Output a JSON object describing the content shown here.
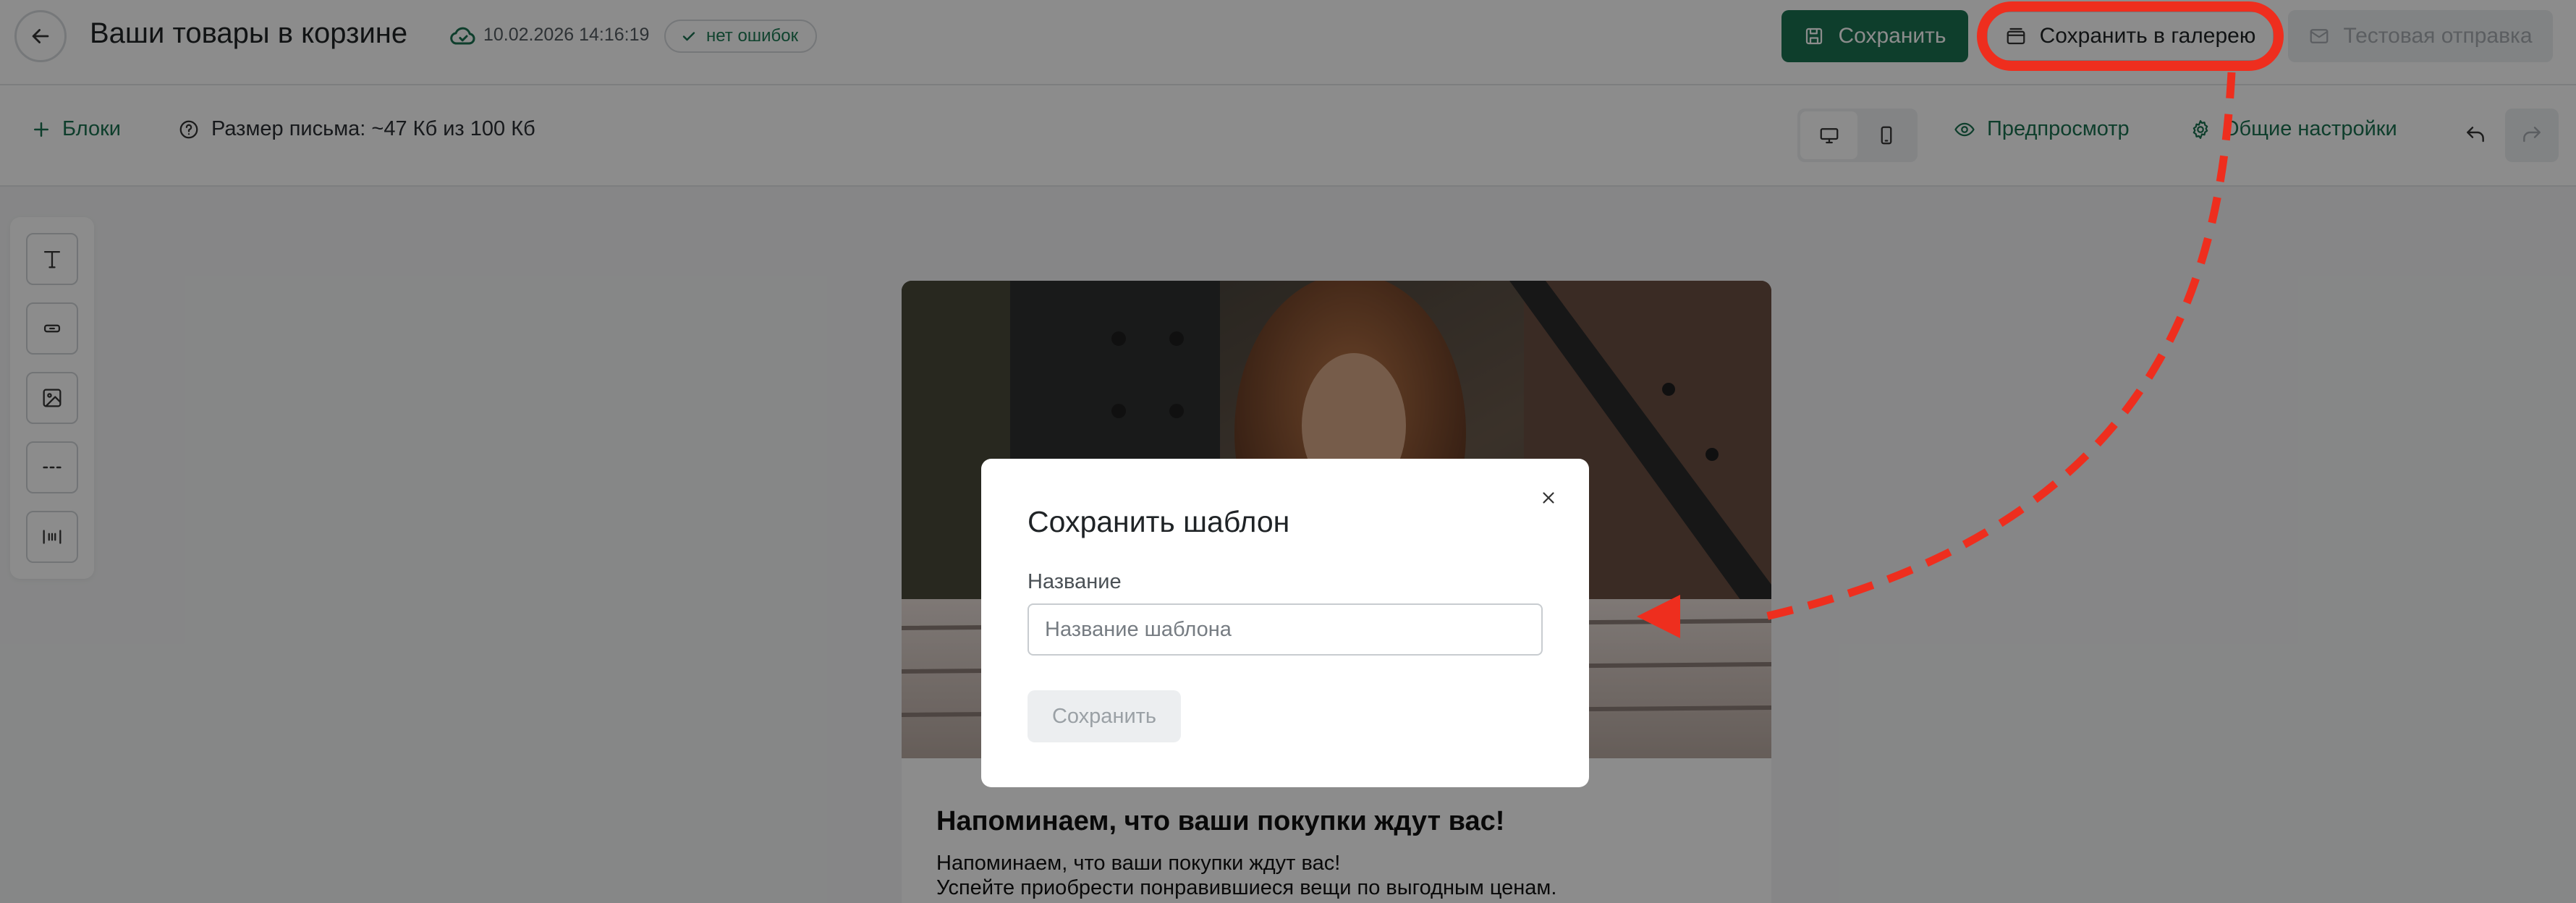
{
  "header": {
    "title": "Ваши товары в корзине",
    "saved_time": "10.02.2026 14:16:19",
    "status": "нет ошибок",
    "save_label": "Сохранить",
    "gallery_label": "Сохранить в галерею",
    "test_label": "Тестовая отправка"
  },
  "toolbar": {
    "blocks_label": "Блоки",
    "size_label": "Размер письма: ~47 Кб из 100 Кб",
    "preview_label": "Предпросмотр",
    "settings_label": "Общие настройки"
  },
  "palette": {
    "items": [
      "text-block",
      "button-block",
      "image-block",
      "divider-block",
      "spacer-block"
    ]
  },
  "email": {
    "heading": "Напоминаем, что ваши покупки ждут вас!",
    "body_line1": "Напоминаем, что ваши покупки ждут вас!",
    "body_line2": "Успейте приобрести понравившиеся вещи по выгодным ценам."
  },
  "modal": {
    "title": "Сохранить шаблон",
    "field_label": "Название",
    "input_placeholder": "Название шаблона",
    "input_value": "",
    "save_label": "Сохранить"
  },
  "colors": {
    "brand_green": "#1a7150",
    "highlight_red": "#ee2e1e"
  },
  "icons": [
    "arrow-left-icon",
    "cloud-check-icon",
    "check-icon",
    "save-icon",
    "gallery-icon",
    "mail-icon",
    "plus-icon",
    "help-circle-icon",
    "desktop-icon",
    "mobile-icon",
    "eye-icon",
    "gear-icon",
    "undo-icon",
    "redo-icon",
    "close-icon"
  ]
}
